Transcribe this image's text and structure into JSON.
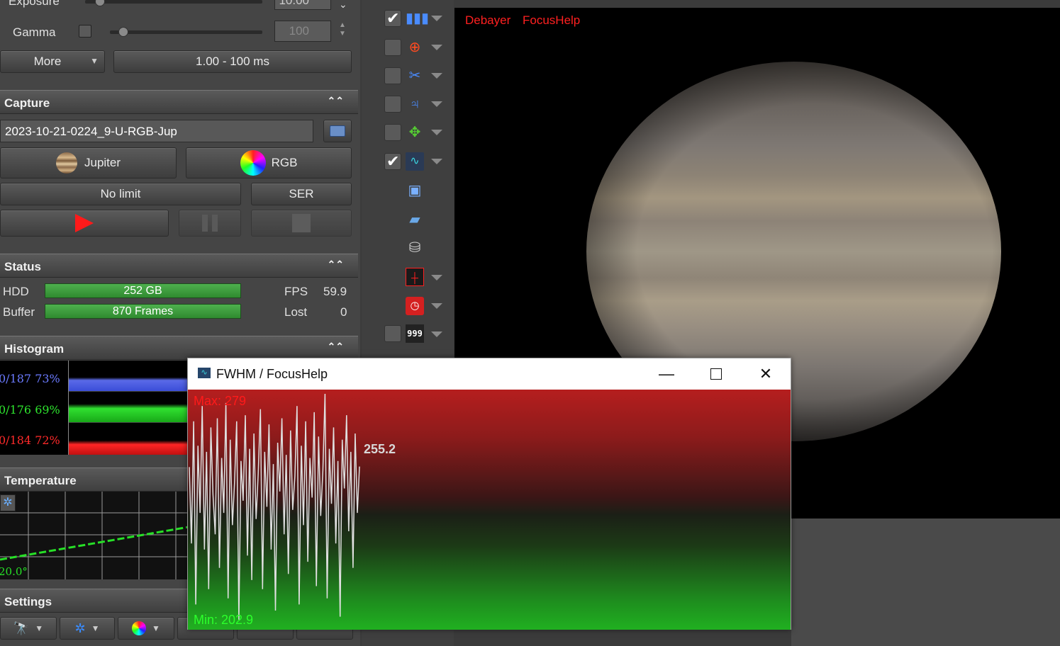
{
  "exposure": {
    "label": "Exposure",
    "value": "10.00"
  },
  "gamma": {
    "label": "Gamma",
    "value": "100"
  },
  "more_button": "More",
  "exposure_range": "1.00 - 100 ms",
  "capture": {
    "header": "Capture",
    "filename": "2023-10-21-0224_9-U-RGB-Jup",
    "object_button": "Jupiter",
    "filter_button": "RGB",
    "limit_button": "No limit",
    "format_button": "SER"
  },
  "status": {
    "header": "Status",
    "hdd_label": "HDD",
    "hdd_value": "252 GB",
    "buffer_label": "Buffer",
    "buffer_value": "870 Frames",
    "fps_label": "FPS",
    "fps_value": "59.9",
    "lost_label": "Lost",
    "lost_value": "0"
  },
  "histogram": {
    "header": "Histogram",
    "rows": [
      {
        "text": "0/187 73%",
        "color": "#6a7aff"
      },
      {
        "text": "0/176 69%",
        "color": "#2ee62e"
      },
      {
        "text": "0/184 72%",
        "color": "#ff2a2a"
      }
    ]
  },
  "temperature": {
    "header": "Temperature",
    "value": "20.0°"
  },
  "settings": {
    "header": "Settings"
  },
  "preview_overlay": {
    "debayer": "Debayer",
    "focushelp": "FocusHelp"
  },
  "fwhm_window": {
    "title": "FWHM / FocusHelp",
    "max_label": "Max: 279",
    "min_label": "Min: 202.9",
    "current_value": "255.2",
    "chart_data": {
      "type": "line",
      "ylim": [
        202.9,
        279
      ],
      "y": [
        255,
        230,
        270,
        210,
        262,
        240,
        275,
        228,
        260,
        215,
        268,
        246,
        233,
        271,
        222,
        258,
        240,
        276,
        212,
        264,
        236,
        250,
        270,
        205,
        257,
        244,
        272,
        226,
        261,
        218,
        266,
        238,
        253,
        274,
        215,
        260,
        242,
        269,
        228,
        256,
        208,
        263,
        247,
        271,
        233,
        259,
        220,
        267,
        241,
        252,
        275,
        210,
        262,
        236,
        270,
        224,
        258,
        245,
        273,
        216,
        265,
        239,
        254,
        279,
        212,
        261,
        243,
        268,
        230,
        257,
        206,
        264,
        248,
        272,
        234,
        260,
        222,
        266,
        240,
        255.2
      ]
    }
  },
  "icons": {
    "histogram": "histogram-icon",
    "crosshair": "crosshair-icon",
    "scissors": "scissors-icon",
    "jupiter_symbol": "jupiter-symbol-icon",
    "move": "move-arrows-icon",
    "focus_graph": "focus-graph-icon",
    "capture_image": "capture-image-icon",
    "folder": "folder-icon",
    "trash": "trash-icon",
    "roi": "roi-icon",
    "clock": "clock-icon",
    "counter": "counter-icon"
  }
}
